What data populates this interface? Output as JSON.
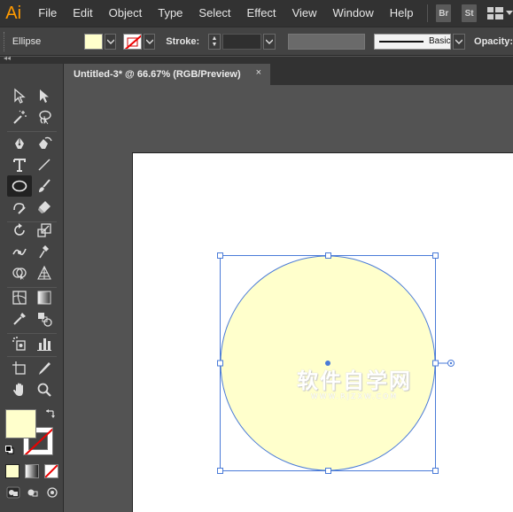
{
  "app": {
    "logo_text": "Ai",
    "accent": "#ff9a00"
  },
  "menu": {
    "items": [
      "File",
      "Edit",
      "Object",
      "Type",
      "Select",
      "Effect",
      "View",
      "Window",
      "Help"
    ],
    "bridge_label": "Br",
    "stock_label": "St",
    "workspace_icon": "workspace-grid-icon"
  },
  "control_bar": {
    "selection_type": "Ellipse",
    "fill_color": "#ffffcc",
    "stroke_color": "none",
    "stroke_label": "Stroke:",
    "stroke_weight": "",
    "brush_label": "Basic",
    "opacity_label": "Opacity:"
  },
  "document": {
    "tab_title": "Untitled-3* @ 66.67% (RGB/Preview)",
    "close_label": "×"
  },
  "artboard": {
    "ellipse_fill": "#ffffcc",
    "ellipse_stroke": "#4a7bd8",
    "selection_color": "#4a7bd8"
  },
  "watermark": {
    "main": "软件自学网",
    "sub": "WWW.RJZXW.COM"
  },
  "toolbar": {
    "tools": [
      [
        "selection-tool-icon",
        "direct-selection-tool-icon"
      ],
      [
        "magic-wand-tool-icon",
        "lasso-tool-icon"
      ],
      [
        "pen-tool-icon",
        "curvature-tool-icon"
      ],
      [
        "type-tool-icon",
        "line-segment-tool-icon"
      ],
      [
        "ellipse-tool-icon",
        "paintbrush-tool-icon"
      ],
      [
        "shaper-tool-icon",
        "eraser-tool-icon"
      ],
      [
        "rotate-tool-icon",
        "scale-tool-icon"
      ],
      [
        "width-tool-icon",
        "puppet-warp-tool-icon"
      ],
      [
        "shape-builder-tool-icon",
        "perspective-grid-tool-icon"
      ],
      [
        "mesh-tool-icon",
        "gradient-tool-icon"
      ],
      [
        "eyedropper-tool-icon",
        "blend-tool-icon"
      ],
      [
        "symbol-sprayer-tool-icon",
        "column-graph-tool-icon"
      ],
      [
        "artboard-tool-icon",
        "slice-tool-icon"
      ],
      [
        "hand-tool-icon",
        "zoom-tool-icon"
      ]
    ],
    "fill_color": "#ffffcc",
    "stroke_color": "none"
  }
}
